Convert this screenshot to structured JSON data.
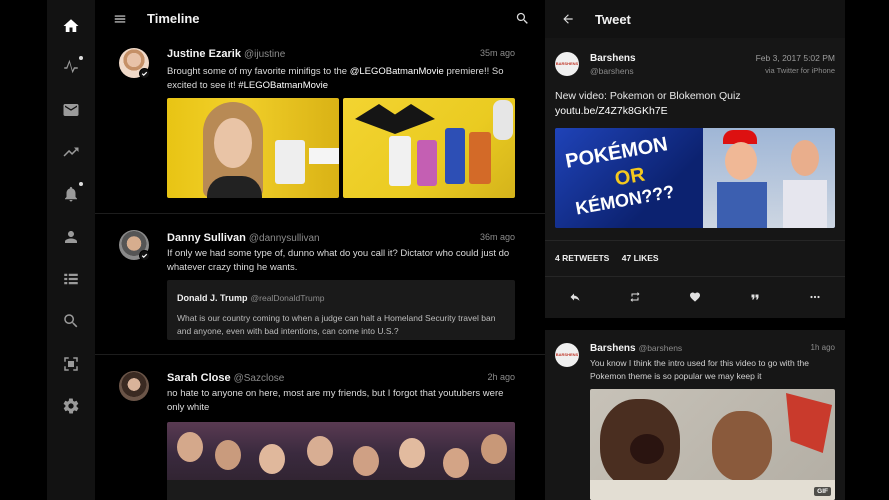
{
  "colors": {
    "background": "#000000",
    "rail": "#121212",
    "detail_panel": "#161616",
    "accent_text": "#ffffff",
    "muted": "#8c8c8c"
  },
  "rail": {
    "items": [
      {
        "name": "home-icon",
        "active": true
      },
      {
        "name": "activity-icon",
        "dot": true
      },
      {
        "name": "mail-icon"
      },
      {
        "name": "trending-icon"
      },
      {
        "name": "bell-icon",
        "dot": true
      },
      {
        "name": "person-icon"
      },
      {
        "name": "list-icon"
      },
      {
        "name": "search-icon"
      },
      {
        "name": "scan-icon"
      },
      {
        "name": "settings-icon"
      }
    ]
  },
  "timeline": {
    "title": "Timeline",
    "tweets": [
      {
        "name": "Justine Ezarik",
        "handle": "@ijustine",
        "time": "35m ago",
        "text_parts": [
          "Brought some of my favorite minifigs to the ",
          "@LEGOBatmanMovie",
          " premiere!! So excited to see it! ",
          "#LEGOBatmanMovie"
        ]
      },
      {
        "name": "Danny Sullivan",
        "handle": "@dannysullivan",
        "time": "36m ago",
        "text": "If only we had some type of, dunno what do you call it? Dictator who could just do whatever crazy thing he wants.",
        "quote": {
          "name": "Donald J. Trump",
          "handle": "@realDonaldTrump",
          "text": "What is our country coming to when a judge can halt a Homeland Security travel ban and anyone, even with bad intentions, can come into U.S.?"
        }
      },
      {
        "name": "Sarah Close",
        "handle": "@Sazclose",
        "time": "2h ago",
        "text": "no hate to anyone on here, most are my friends, but I forgot that youtubers were only white"
      }
    ]
  },
  "detail": {
    "title": "Tweet",
    "name": "Barshens",
    "handle": "@barshens",
    "date": "Feb 3, 2017 5:02 PM",
    "via": "via Twitter for iPhone",
    "text_prefix": "New video: Pokemon or Blokemon Quiz ",
    "link": "youtu.be/Z4Z7k8GKh7E",
    "media_words": [
      "POKÉMON",
      "OR",
      "KÉMON???"
    ],
    "retweets": "4",
    "retweets_label": "RETWEETS",
    "likes": "47",
    "likes_label": "LIKES",
    "reply": {
      "name": "Barshens",
      "handle": "@barshens",
      "time": "1h ago",
      "text": "You know I think the intro used for this video to go with the Pokemon theme is so popular we may keep it",
      "badge": "GIF"
    }
  }
}
